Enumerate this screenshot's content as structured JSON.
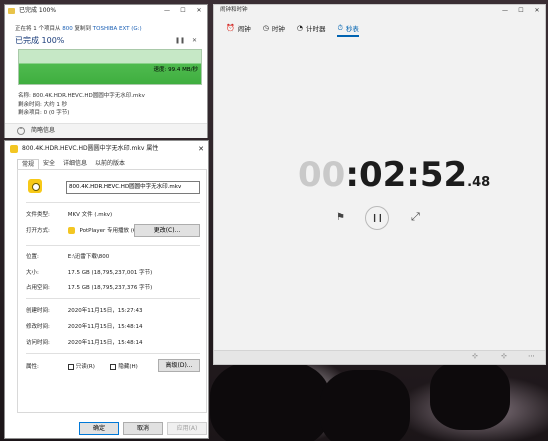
{
  "copy_dialog": {
    "title": "已完成 100%",
    "line1_prefix": "正在将 1 个项目从",
    "source": "800",
    "line1_mid": "复制到",
    "target": "TOSHIBA EXT (G:)",
    "progress_heading": "已完成 100%",
    "progress_value": 1.0,
    "speed": "速度: 99.4 MB/秒",
    "pause_icon": "pause-icon",
    "close_icon": "close-icon",
    "name_line": "名称: 800.4K.HDR.HEVC.HD圆圆中字无水印.mkv",
    "remaining_line": "剩余时间: 大约 1 秒",
    "items_line": "剩余项目: 0 (0 字节)",
    "less_info": "简略信息"
  },
  "properties_dialog": {
    "title": "800.4K.HDR.HEVC.HD圆圆中字无水印.mkv 属性",
    "tabs": [
      "常规",
      "安全",
      "详细信息",
      "以前的版本"
    ],
    "file_name": "800.4K.HDR.HEVC.HD圆圆中字无水印.mkv",
    "rows": {
      "type_label": "文件类型:",
      "type_value": "MKV 文件 (.mkv)",
      "open_label": "打开方式:",
      "open_value": "PotPlayer 专用播放 (64",
      "change_button": "更改(C)...",
      "location_label": "位置:",
      "location_value": "E:\\迅雷下载\\800",
      "size_label": "大小:",
      "size_value": "17.5 GB (18,795,237,001 字节)",
      "disk_label": "占用空间:",
      "disk_value": "17.5 GB (18,795,237,376 字节)",
      "created_label": "创建时间:",
      "created_value": "2020年11月15日，15:27:43",
      "modified_label": "修改时间:",
      "modified_value": "2020年11月15日，15:48:14",
      "accessed_label": "访问时间:",
      "accessed_value": "2020年11月15日，15:48:14",
      "attr_label": "属性:",
      "readonly_label": "只读(R)",
      "hidden_label": "隐藏(H)",
      "advanced_button": "高级(D)..."
    },
    "buttons": {
      "ok": "确定",
      "cancel": "取消",
      "apply": "应用(A)"
    }
  },
  "clock_app": {
    "title": "闹钟和时钟",
    "tabs": [
      {
        "label": "闹钟",
        "icon": "alarm-icon"
      },
      {
        "label": "时钟",
        "icon": "world-clock-icon"
      },
      {
        "label": "计时器",
        "icon": "timer-icon"
      },
      {
        "label": "秒表",
        "icon": "stopwatch-icon"
      }
    ],
    "active_tab": "秒表",
    "stopwatch": {
      "hours": "00",
      "colon": ":",
      "minsec": "02:52",
      "centis": ".48"
    },
    "accent": "#0063b1"
  }
}
